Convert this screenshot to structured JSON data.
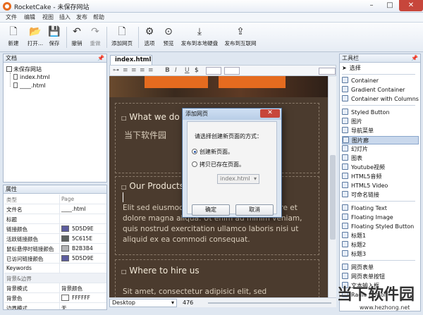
{
  "window": {
    "title": "RocketCake - 未保存网站"
  },
  "window_controls": {
    "minimize": "–",
    "maximize": "□",
    "close": "✕"
  },
  "menu": [
    "文件",
    "编辑",
    "视图",
    "插入",
    "发布",
    "帮助"
  ],
  "toolbar": {
    "new": "新建",
    "open": "打开...",
    "save": "保存",
    "undo": "撤销",
    "redo": "重做",
    "add_page": "添加网页",
    "options": "选项",
    "preview": "预览",
    "publish_local": "发布到本地硬盘",
    "publish_web": "发布到互联网"
  },
  "document_panel": {
    "title": "文档",
    "pin": "📌",
    "tree": [
      "未保存网站",
      "index.html",
      "____.html"
    ]
  },
  "properties_panel": {
    "title": "属性",
    "rows": [
      {
        "key": "类型",
        "value": "Page"
      },
      {
        "key": "文件名",
        "value": "____.html"
      },
      {
        "key": "标题",
        "value": ""
      },
      {
        "key": "链接颜色",
        "value": "5D5D9E",
        "color": "#5D5D9E"
      },
      {
        "key": "活跃链接颜色",
        "value": "5C615E",
        "color": "#5C615E"
      },
      {
        "key": "鼠标悬停时链接颜色",
        "value": "B2B3B4",
        "color": "#B2B3B4"
      },
      {
        "key": "已访问链接颜色",
        "value": "5D5D9E",
        "color": "#5D5D9E"
      },
      {
        "key": "Keywords",
        "value": ""
      },
      {
        "key": "背景&边界",
        "value": ""
      },
      {
        "key": "背景模式",
        "value": "背景颜色"
      },
      {
        "key": "背景色",
        "value": "FFFFFF",
        "color": "#FFFFFF"
      },
      {
        "key": "边界模式",
        "value": "无"
      }
    ]
  },
  "editor": {
    "tab": "index.html",
    "format_tools": [
      "≡",
      "≡",
      "≡",
      "≡",
      "B",
      "I",
      "U",
      "$"
    ],
    "sections": [
      {
        "title": "What we do",
        "text": "当下软件园"
      },
      {
        "title": "Our Products",
        "text": "Elit sed eiusmod tempor incididunt ut labore et dolore magna aliqua. Ut enim ad minim veniam, quis nostrud exercitation ullamco laboris nisi ut aliquid ex ea commodi consequat."
      },
      {
        "title": "Where to hire us",
        "text": "Sit amet, consectetur adipisici elit, sed"
      }
    ],
    "device": "Desktop",
    "width": "476"
  },
  "dialog": {
    "title": "添加网页",
    "close": "✕",
    "prompt": "请选择创建新页面的方式：",
    "option_new": "创建新页面。",
    "option_copy": "拷贝已存在页面。",
    "page_select": "index.html",
    "ok": "确定",
    "cancel": "取消"
  },
  "toolbox": {
    "title": "工具栏",
    "pin": "📌",
    "items": [
      "选择",
      "Container",
      "Gradient Container",
      "Container with Columns",
      "Styled Button",
      "图片",
      "导航菜单",
      "图片廊",
      "幻灯片",
      "图表",
      "Youtube视频",
      "HTML5音频",
      "HTML5 Video",
      "可命名链接",
      "Floating Text",
      "Floating Image",
      "Floating Styled Button",
      "标题1",
      "标题2",
      "标题3",
      "网页表单",
      "网页表单按钮",
      "文本输入框",
      "Radio Button"
    ]
  },
  "watermark": {
    "text": "当下软件园",
    "url": "www.hezhong.net"
  }
}
